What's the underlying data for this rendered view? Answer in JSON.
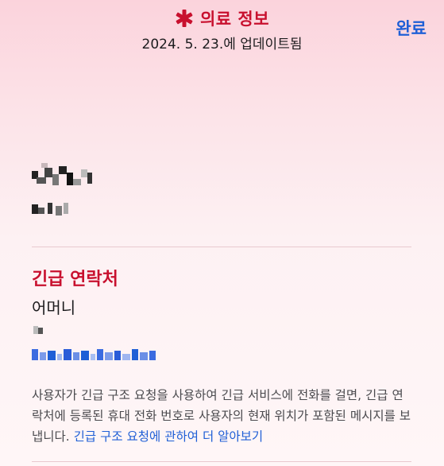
{
  "header": {
    "title": "의료 정보",
    "updated": "2024. 5. 23.에 업데이트됨",
    "done_label": "완료",
    "icon": "medical-asterisk-icon",
    "accent_color": "#c8102e",
    "link_color": "#1f5fd6"
  },
  "emergency": {
    "section_title": "긴급 연락처",
    "contact_relation": "어머니",
    "description": "사용자가 긴급 구조 요청을 사용하여 긴급 서비스에 전화를 걸면, 긴급 연락처에 등록된 휴대 전화 번호로 사용자의 현재 위치가 포함된 메시지를 보냅니다. ",
    "learn_more_link": "긴급 구조 요청에 관하여 더 알아보기"
  }
}
